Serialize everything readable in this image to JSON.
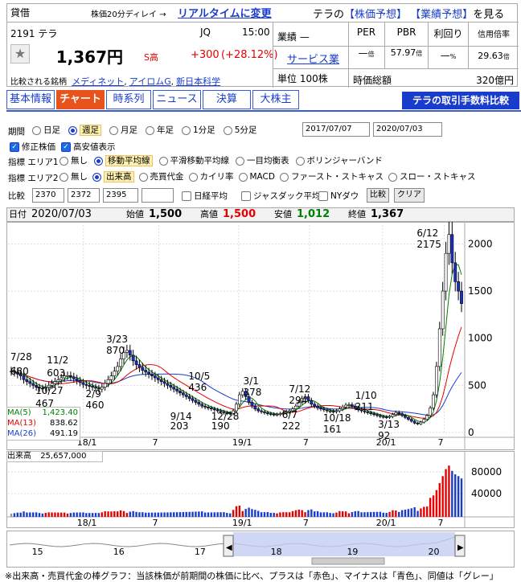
{
  "header": {
    "tag": "貸借",
    "delay_note": "株価20分ディレイ →",
    "realtime_link": "リアルタイムに変更",
    "code": "2191",
    "name": "テラ",
    "market": "JQ",
    "time": "15:00",
    "price": "1,367円",
    "s_label": "S高",
    "change": "+300",
    "change_pct": "(+28.12%)",
    "compare_label": "比較される銘柄",
    "compare_links": [
      "メディネット",
      "アイロムG",
      "新日本科学"
    ],
    "forecast_prefix": "テラの",
    "forecast1": "【株価予想】",
    "forecast2": "【業績予想】",
    "forecast_suffix": "を見る",
    "gyoseki_label": "業績",
    "gyoseki_value": "—",
    "sector": "サービス業",
    "unit_label": "単位",
    "unit_value": "100株",
    "per_label": "PER",
    "pbr_label": "PBR",
    "yield_label": "利回り",
    "margin_label": "信用倍率",
    "per_value": "—",
    "per_unit": "倍",
    "pbr_value": "57.97",
    "pbr_unit": "倍",
    "yield_value": "—",
    "yield_unit": "%",
    "margin_value": "29.63",
    "margin_unit": "倍",
    "mcap_label": "時価総額",
    "mcap_value": "320億円"
  },
  "tabs": [
    {
      "label": "基本情報",
      "active": false
    },
    {
      "label": "チャート",
      "active": true
    },
    {
      "label": "時系列",
      "active": false
    },
    {
      "label": "ニュース",
      "active": false
    },
    {
      "label": "決算",
      "active": false
    },
    {
      "label": "大株主",
      "active": false
    }
  ],
  "fee_banner": "テラの取引手数料比較",
  "controls": {
    "period_label": "期間",
    "periods": [
      "日足",
      "週足",
      "月足",
      "年足",
      "1分足",
      "5分足"
    ],
    "period_selected": "週足",
    "date_from": "2017/07/07",
    "date_to": "2020/07/03",
    "checks": [
      "修正株価",
      "高安値表示"
    ],
    "area1_label": "指標 エリア1",
    "area1_opts": [
      "無し",
      "移動平均線",
      "平滑移動平均線",
      "一目均衡表",
      "ボリンジャーバンド"
    ],
    "area1_selected": "移動平均線",
    "area2_label": "指標 エリア2",
    "area2_opts": [
      "無し",
      "出来高",
      "売買代金",
      "カイリ率",
      "MACD",
      "ファースト・ストキャス",
      "スロー・ストキャス"
    ],
    "area2_selected": "出来高",
    "compare_label": "比較",
    "compare_codes": [
      "2370",
      "2372",
      "2395",
      ""
    ],
    "compare_checks": [
      "日経平均",
      "ジャスダック平均",
      "NYダウ"
    ],
    "compare_btn": "比較",
    "clear_btn": "クリア"
  },
  "ohlc": {
    "date_label": "日付",
    "date": "2020/07/03",
    "open_label": "始値",
    "open": "1,500",
    "high_label": "高値",
    "high": "1,500",
    "low_label": "安値",
    "low": "1,012",
    "close_label": "終値",
    "close": "1,367"
  },
  "ma_legend": [
    {
      "label": "MA(5)",
      "value": "1,423.40",
      "color": "#008000"
    },
    {
      "label": "MA(13)",
      "value": "838.62",
      "color": "#e60000"
    },
    {
      "label": "MA(26)",
      "value": "491.19",
      "color": "#1a3ccc"
    }
  ],
  "volume_label": "出来高",
  "volume_value": "25,657,000",
  "footnote": "※出来高・売買代金の棒グラフ：当該株価が前期間の株価に比べ、プラスは「赤色」、マイナスは「青色」、同値は「グレー」",
  "chart_data": {
    "type": "candlestick",
    "x_ticks": [
      "18/1",
      "7",
      "19/1",
      "7",
      "20/1",
      "7"
    ],
    "y_ticks": [
      0,
      500,
      1000,
      1500,
      2000
    ],
    "ylim": [
      0,
      2200
    ],
    "volume_ticks": [
      "40000",
      "80000"
    ],
    "navigator_ticks": [
      "15",
      "16",
      "17",
      "18",
      "19",
      "20"
    ],
    "annotations": [
      {
        "date": "7/28",
        "value": "680"
      },
      {
        "date": "11/2",
        "value": "603"
      },
      {
        "date": "10/27",
        "value": "467"
      },
      {
        "date": "2/9",
        "value": "460"
      },
      {
        "date": "3/23",
        "value": "870"
      },
      {
        "date": "10/5",
        "value": "436"
      },
      {
        "date": "9/14",
        "value": "203"
      },
      {
        "date": "12/28",
        "value": "190"
      },
      {
        "date": "3/1",
        "value": "378"
      },
      {
        "date": "6/7",
        "value": "222"
      },
      {
        "date": "7/12",
        "value": "294"
      },
      {
        "date": "10/18",
        "value": "161"
      },
      {
        "date": "1/10",
        "value": "211"
      },
      {
        "date": "3/13",
        "value": "92"
      },
      {
        "date": "6/12",
        "value": "2175"
      }
    ],
    "close": [
      650,
      640,
      620,
      600,
      560,
      540,
      520,
      500,
      480,
      470,
      468,
      480,
      500,
      520,
      540,
      560,
      580,
      600,
      603,
      590,
      570,
      550,
      530,
      510,
      500,
      490,
      480,
      470,
      460,
      480,
      520,
      560,
      600,
      650,
      700,
      780,
      850,
      870,
      820,
      760,
      720,
      690,
      660,
      640,
      620,
      600,
      580,
      560,
      540,
      520,
      500,
      480,
      460,
      440,
      420,
      400,
      380,
      360,
      340,
      320,
      300,
      280,
      270,
      260,
      250,
      240,
      230,
      220,
      210,
      205,
      203,
      230,
      300,
      400,
      436,
      380,
      320,
      280,
      250,
      230,
      220,
      210,
      200,
      195,
      190,
      192,
      200,
      210,
      220,
      230,
      250,
      280,
      320,
      360,
      378,
      340,
      300,
      280,
      260,
      250,
      240,
      230,
      225,
      222,
      230,
      250,
      270,
      290,
      294,
      280,
      260,
      240,
      230,
      220,
      210,
      200,
      190,
      180,
      170,
      165,
      161,
      170,
      190,
      211,
      200,
      180,
      160,
      140,
      120,
      100,
      92,
      110,
      140,
      180,
      260,
      400,
      700,
      1100,
      1500,
      1900,
      2100,
      1800,
      1600,
      1500,
      1367
    ],
    "ma5": [],
    "ma13": [],
    "ma26": [],
    "volume": []
  }
}
